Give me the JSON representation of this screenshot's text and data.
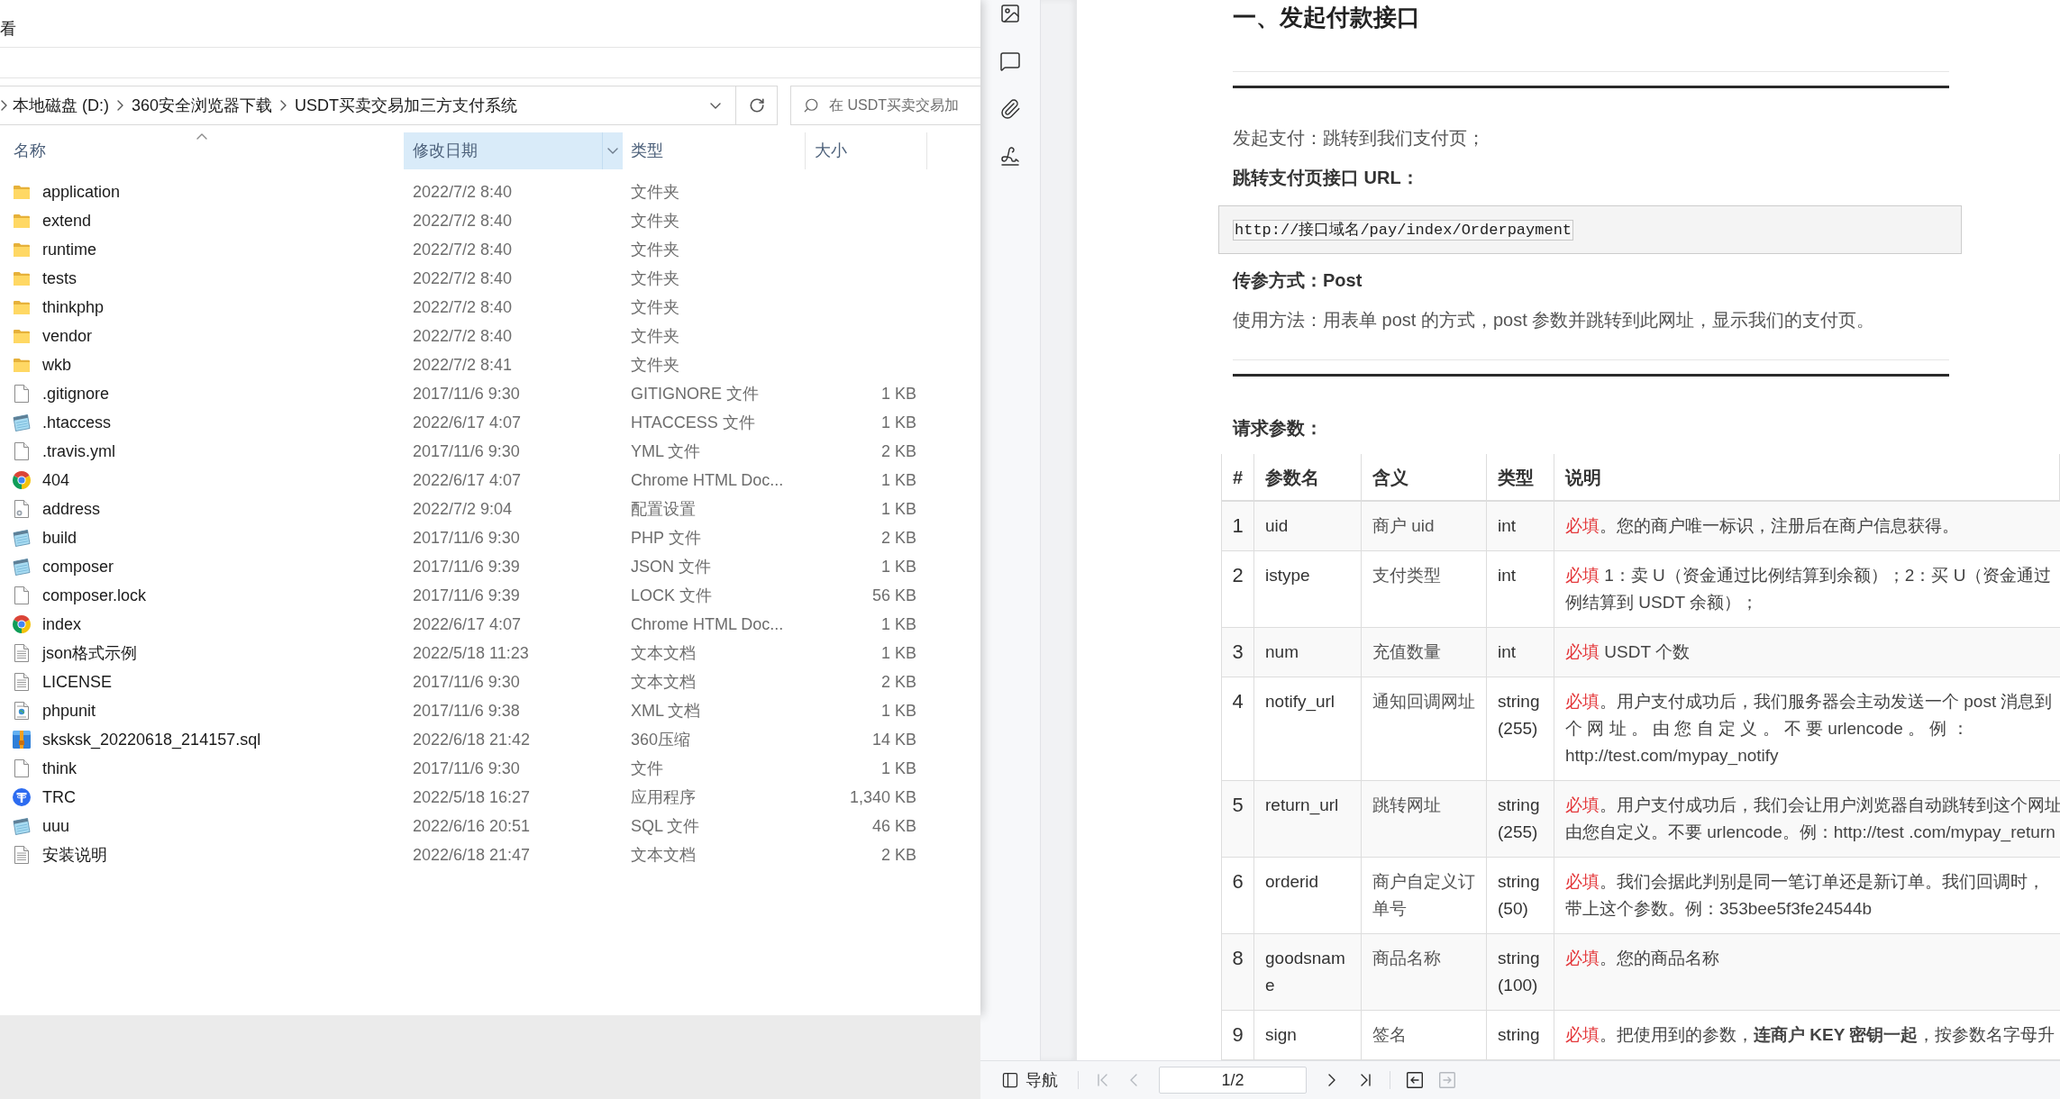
{
  "explorer": {
    "ribbon_tab": "看",
    "path": [
      "本地磁盘 (D:)",
      "360安全浏览器下载",
      "USDT买卖交易加三方支付系统"
    ],
    "search": {
      "placeholder": "在 USDT买卖交易加"
    },
    "columns": [
      {
        "label": "名称",
        "selected": false,
        "sorted": true
      },
      {
        "label": "修改日期",
        "selected": true,
        "sorted": false
      },
      {
        "label": "类型",
        "selected": false,
        "sorted": false
      },
      {
        "label": "大小",
        "selected": false,
        "sorted": false
      }
    ],
    "files": [
      {
        "kind": "folder",
        "name": "application",
        "modified": "2022/7/2 8:40",
        "type": "文件夹"
      },
      {
        "kind": "folder",
        "name": "extend",
        "modified": "2022/7/2 8:40",
        "type": "文件夹"
      },
      {
        "kind": "folder",
        "name": "runtime",
        "modified": "2022/7/2 8:40",
        "type": "文件夹"
      },
      {
        "kind": "folder",
        "name": "tests",
        "modified": "2022/7/2 8:40",
        "type": "文件夹"
      },
      {
        "kind": "folder",
        "name": "thinkphp",
        "modified": "2022/7/2 8:40",
        "type": "文件夹"
      },
      {
        "kind": "folder",
        "name": "vendor",
        "modified": "2022/7/2 8:40",
        "type": "文件夹"
      },
      {
        "kind": "folder",
        "name": "wkb",
        "modified": "2022/7/2 8:41",
        "type": "文件夹"
      },
      {
        "kind": "blank",
        "name": ".gitignore",
        "modified": "2017/11/6 9:30",
        "type": "GITIGNORE 文件",
        "size": "1 KB"
      },
      {
        "kind": "notepad",
        "name": ".htaccess",
        "modified": "2022/6/17 4:07",
        "type": "HTACCESS 文件",
        "size": "1 KB"
      },
      {
        "kind": "blank",
        "name": ".travis.yml",
        "modified": "2017/11/6 9:30",
        "type": "YML 文件",
        "size": "2 KB"
      },
      {
        "kind": "browser",
        "name": "404",
        "modified": "2022/6/17 4:07",
        "type": "Chrome HTML Doc...",
        "size": "1 KB"
      },
      {
        "kind": "config",
        "name": "address",
        "modified": "2022/7/2 9:04",
        "type": "配置设置",
        "size": "1 KB"
      },
      {
        "kind": "notepad",
        "name": "build",
        "modified": "2017/11/6 9:30",
        "type": "PHP 文件",
        "size": "2 KB"
      },
      {
        "kind": "notepad",
        "name": "composer",
        "modified": "2017/11/6 9:39",
        "type": "JSON 文件",
        "size": "1 KB"
      },
      {
        "kind": "blank",
        "name": "composer.lock",
        "modified": "2017/11/6 9:39",
        "type": "LOCK 文件",
        "size": "56 KB"
      },
      {
        "kind": "browser",
        "name": "index",
        "modified": "2022/6/17 4:07",
        "type": "Chrome HTML Doc...",
        "size": "1 KB"
      },
      {
        "kind": "text",
        "name": "json格式示例",
        "modified": "2022/5/18 11:23",
        "type": "文本文档",
        "size": "1 KB"
      },
      {
        "kind": "text",
        "name": "LICENSE",
        "modified": "2017/11/6 9:30",
        "type": "文本文档",
        "size": "2 KB"
      },
      {
        "kind": "xml",
        "name": "phpunit",
        "modified": "2017/11/6 9:38",
        "type": "XML 文档",
        "size": "1 KB"
      },
      {
        "kind": "archive",
        "name": "sksksk_20220618_214157.sql",
        "modified": "2022/6/18 21:42",
        "type": "360压缩",
        "size": "14 KB"
      },
      {
        "kind": "blank",
        "name": "think",
        "modified": "2017/11/6 9:30",
        "type": "文件",
        "size": "1 KB"
      },
      {
        "kind": "app",
        "name": "TRC",
        "modified": "2022/5/18 16:27",
        "type": "应用程序",
        "size": "1,340 KB"
      },
      {
        "kind": "notepad",
        "name": "uuu",
        "modified": "2022/6/16 20:51",
        "type": "SQL 文件",
        "size": "46 KB"
      },
      {
        "kind": "text",
        "name": "安装说明",
        "modified": "2022/6/18 21:47",
        "type": "文本文档",
        "size": "2 KB"
      }
    ]
  },
  "viewer": {
    "document": {
      "title": "一、发起付款接口",
      "intro": "发起支付：跳转到我们支付页；",
      "url_label": "跳转支付页接口 URL：",
      "url": "http://接口域名/pay/index/Orderpayment",
      "method_label": "传参方式：Post",
      "usage": "使用方法：用表单 post 的方式，post 参数并跳转到此网址，显示我们的支付页。",
      "params_label": "请求参数：",
      "table": {
        "columns": [
          "#",
          "参数名",
          "含义",
          "类型",
          "说明"
        ],
        "rows": [
          {
            "index": "1",
            "name": [
              "uid"
            ],
            "meaning": [
              "商户 uid"
            ],
            "type": [
              "int"
            ],
            "required": "必填",
            "description": [
              "。您的商户唯一标识，注册后在商户信息获得。"
            ]
          },
          {
            "index": "2",
            "name": [
              "istype"
            ],
            "meaning": [
              "支付类型"
            ],
            "type": [
              "int"
            ],
            "required": "必填",
            "description": [
              " 1：卖 U（资金通过比例结算到余额）；2：买 U（资金通过",
              "例结算到 USDT 余额）；"
            ]
          },
          {
            "index": "3",
            "name": [
              "num"
            ],
            "meaning": [
              "充值数量"
            ],
            "type": [
              "int"
            ],
            "required": "必填",
            "description": [
              " USDT 个数"
            ]
          },
          {
            "index": "4",
            "name": [
              "notify_url"
            ],
            "meaning": [
              "通知回调网址"
            ],
            "type": [
              "string",
              "(255)"
            ],
            "required": "必填",
            "description": [
              "。用户支付成功后，我们服务器会主动发送一个 post 消息到",
              "个 网 址 。 由 您 自 定 义 。 不 要 urlencode 。 例 ：",
              "http://test.com/mypay_notify"
            ]
          },
          {
            "index": "5",
            "name": [
              "return_url"
            ],
            "meaning": [
              "跳转网址"
            ],
            "type": [
              "string",
              "(255)"
            ],
            "required": "必填",
            "description": [
              "。用户支付成功后，我们会让用户浏览器自动跳转到这个网址",
              "由您自定义。不要 urlencode。例：http://test .com/mypay_return"
            ]
          },
          {
            "index": "6",
            "name": [
              "orderid"
            ],
            "meaning": [
              "商户自定义订",
              "单号"
            ],
            "type": [
              "string",
              "(50)"
            ],
            "required": "必填",
            "description": [
              "。我们会据此判别是同一笔订单还是新订单。我们回调时，",
              "带上这个参数。例：353bee5f3fe24544b"
            ]
          },
          {
            "index": "8",
            "name": [
              "goodsnam",
              "e"
            ],
            "meaning": [
              "商品名称"
            ],
            "type": [
              "string",
              "(100)"
            ],
            "required": "必填",
            "description": [
              "。您的商品名称"
            ]
          },
          {
            "index": "9",
            "name": [
              "sign"
            ],
            "meaning": [
              "签名"
            ],
            "type": [
              "string"
            ],
            "required": "必填",
            "description": [
              "。把使用到的参数，**连商户 KEY 密钥一起**，按参数名字母升"
            ]
          }
        ]
      }
    },
    "bottom_bar": {
      "nav_label": "导航",
      "pager_before": [
        {
          "kind": "first",
          "disabled": true
        },
        {
          "kind": "prev",
          "disabled": true
        }
      ],
      "page": "1/2",
      "pager_after": [
        {
          "kind": "next",
          "disabled": false
        },
        {
          "kind": "last",
          "disabled": false
        }
      ],
      "history": [
        {
          "kind": "back",
          "disabled": false
        },
        {
          "kind": "forward",
          "disabled": true
        }
      ]
    }
  }
}
